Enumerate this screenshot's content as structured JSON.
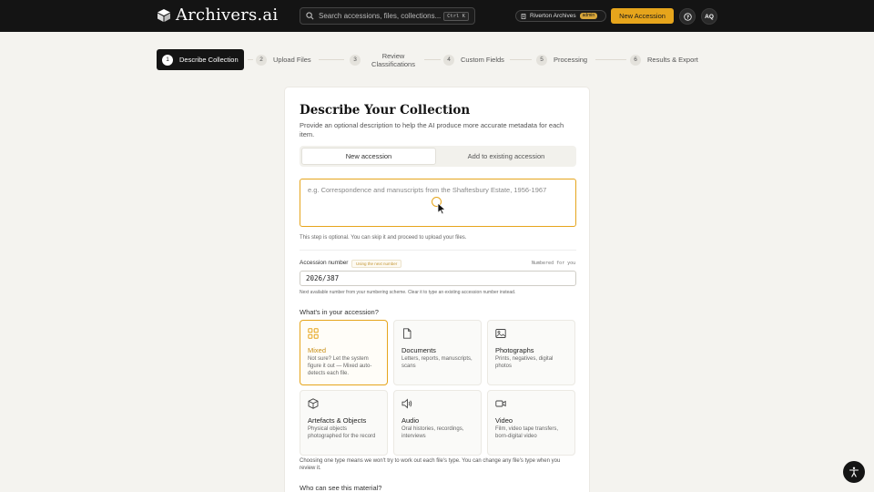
{
  "app": {
    "name": "Archivers.ai"
  },
  "search": {
    "placeholder": "Search accessions, files, collections...",
    "shortcut": "Ctrl K"
  },
  "org": {
    "name": "Riverton Archives",
    "role": "admin"
  },
  "header": {
    "new_accession_label": "New Accession",
    "help_icon": "?",
    "avatar_initials": "AQ"
  },
  "stepper": {
    "steps": [
      {
        "num": "1",
        "label": "Describe Collection",
        "active": true
      },
      {
        "num": "2",
        "label": "Upload Files"
      },
      {
        "num": "3",
        "label": "Review Classifications"
      },
      {
        "num": "4",
        "label": "Custom Fields"
      },
      {
        "num": "5",
        "label": "Processing"
      },
      {
        "num": "6",
        "label": "Results & Export"
      }
    ]
  },
  "form": {
    "title": "Describe Your Collection",
    "subtitle": "Provide an optional description to help the AI produce more accurate metadata for each item.",
    "mode": {
      "new_label": "New accession",
      "existing_label": "Add to existing accession",
      "selected": "new"
    },
    "description": {
      "value": "",
      "placeholder": "e.g. Correspondence and manuscripts from the Shaftesbury Estate, 1956-1967"
    },
    "optional_hint": "This step is optional. You can skip it and proceed to upload your files.",
    "accession": {
      "label": "Accession number",
      "chip": "Using the next number",
      "right_note": "Numbered for you",
      "value": "2026/387",
      "hint": "Next available number from your numbering scheme. Clear it to type an existing accession number instead."
    },
    "material_label": "What's in your accession?",
    "types": [
      {
        "key": "mixed",
        "icon": "grid-icon",
        "title": "Mixed",
        "desc": "Not sure? Let the system figure it out — Mixed auto-detects each file.",
        "selected": true
      },
      {
        "key": "documents",
        "icon": "document-icon",
        "title": "Documents",
        "desc": "Letters, reports, manuscripts, scans"
      },
      {
        "key": "photographs",
        "icon": "image-icon",
        "title": "Photographs",
        "desc": "Prints, negatives, digital photos"
      },
      {
        "key": "artefacts",
        "icon": "cube-icon",
        "title": "Artefacts & Objects",
        "desc": "Physical objects photographed for the record"
      },
      {
        "key": "audio",
        "icon": "speaker-icon",
        "title": "Audio",
        "desc": "Oral histories, recordings, interviews"
      },
      {
        "key": "video",
        "icon": "video-icon",
        "title": "Video",
        "desc": "Film, video tape transfers, born-digital video"
      }
    ],
    "choose_hint": "Choosing one type means we won't try to work out each file's type. You can change any file's type when you review it.",
    "visibility_label": "Who can see this material?"
  },
  "colors": {
    "accent": "#e6a51c",
    "topbar": "#141414",
    "background": "#f4f3ef"
  }
}
